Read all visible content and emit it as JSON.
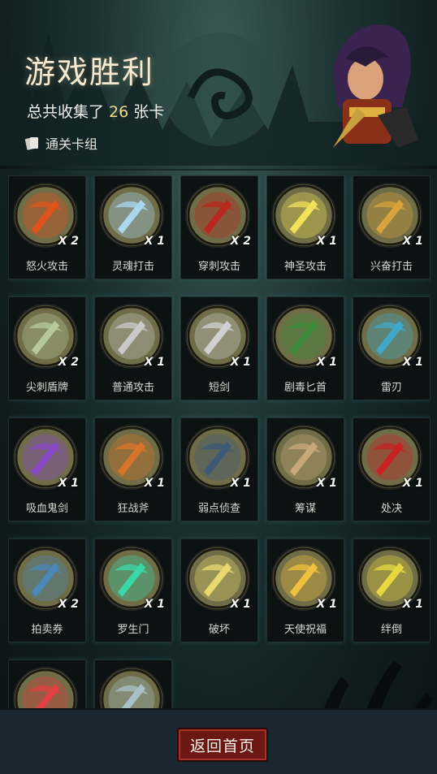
{
  "header": {
    "title": "游戏胜利",
    "subtitle_prefix": "总共收集了",
    "card_total": "26",
    "subtitle_suffix": "张卡",
    "deck_label": "通关卡组"
  },
  "cards": [
    {
      "name": "怒火攻击",
      "count": "X 2",
      "icon": "fire-attack-icon",
      "color": "#e0531e"
    },
    {
      "name": "灵魂打击",
      "count": "X 1",
      "icon": "soul-strike-icon",
      "color": "#a9d7f0"
    },
    {
      "name": "穿刺攻击",
      "count": "X 2",
      "icon": "pierce-attack-icon",
      "color": "#b8281e"
    },
    {
      "name": "神圣攻击",
      "count": "X 1",
      "icon": "holy-attack-icon",
      "color": "#f2e25a"
    },
    {
      "name": "兴奋打击",
      "count": "X 1",
      "icon": "excite-strike-icon",
      "color": "#d9a23a"
    },
    {
      "name": "尖刺盾牌",
      "count": "X 2",
      "icon": "spike-shield-icon",
      "color": "#b7c99a"
    },
    {
      "name": "普通攻击",
      "count": "X 1",
      "icon": "sword-icon",
      "color": "#c9c9c9"
    },
    {
      "name": "短剑",
      "count": "X 1",
      "icon": "short-sword-icon",
      "color": "#d0d0d0"
    },
    {
      "name": "剧毒匕首",
      "count": "X 1",
      "icon": "poison-dagger-icon",
      "color": "#3c8a3a"
    },
    {
      "name": "雷刃",
      "count": "X 1",
      "icon": "thunder-blade-icon",
      "color": "#3fa8c8"
    },
    {
      "name": "吸血鬼剑",
      "count": "X 1",
      "icon": "vampire-sword-icon",
      "color": "#8a4ac8"
    },
    {
      "name": "狂战斧",
      "count": "X 1",
      "icon": "berserk-axe-icon",
      "color": "#d8742a"
    },
    {
      "name": "弱点侦查",
      "count": "X 1",
      "icon": "wolf-icon",
      "color": "#3c5a78"
    },
    {
      "name": "筹谋",
      "count": "X 1",
      "icon": "map-icon",
      "color": "#c8a878"
    },
    {
      "name": "处决",
      "count": "X 1",
      "icon": "execute-icon",
      "color": "#c82222"
    },
    {
      "name": "拍卖券",
      "count": "X 2",
      "icon": "auction-icon",
      "color": "#4a88b8"
    },
    {
      "name": "罗生门",
      "count": "X 1",
      "icon": "demon-gate-icon",
      "color": "#38d8a8"
    },
    {
      "name": "破坏",
      "count": "X 1",
      "icon": "destroy-icon",
      "color": "#e8d870"
    },
    {
      "name": "天使祝福",
      "count": "X 1",
      "icon": "angel-bless-icon",
      "color": "#f0c040"
    },
    {
      "name": "绊倒",
      "count": "X 1",
      "icon": "trip-icon",
      "color": "#e8d840"
    },
    {
      "name": "",
      "count": "",
      "icon": "angel-heart-icon",
      "color": "#e04040"
    },
    {
      "name": "",
      "count": "",
      "icon": "stone-golem-icon",
      "color": "#a8c0c8"
    }
  ],
  "footer": {
    "return_label": "返回首页"
  }
}
